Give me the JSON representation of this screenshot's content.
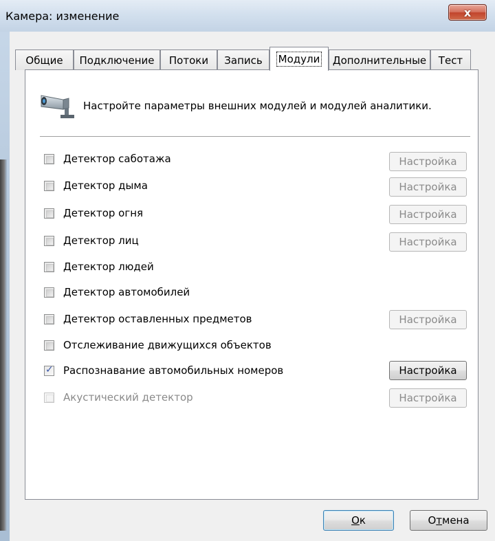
{
  "window": {
    "title": "Камера: изменение",
    "close_glyph": "x"
  },
  "tabs": [
    {
      "label": "Общие",
      "active": false
    },
    {
      "label": "Подключение",
      "active": false
    },
    {
      "label": "Потоки",
      "active": false
    },
    {
      "label": "Запись",
      "active": false
    },
    {
      "label": "Модули",
      "active": true
    },
    {
      "label": "Дополнительные",
      "active": false
    },
    {
      "label": "Тест",
      "active": false
    }
  ],
  "panel": {
    "icon": "camera-icon",
    "intro": "Настройте параметры внешних модулей и модулей аналитики."
  },
  "modules": [
    {
      "label": "Детектор саботажа",
      "checked": false,
      "enabled": true,
      "settings_label": "Настройка",
      "settings_enabled": false
    },
    {
      "label": "Детектор дыма",
      "checked": false,
      "enabled": true,
      "settings_label": "Настройка",
      "settings_enabled": false
    },
    {
      "label": "Детектор огня",
      "checked": false,
      "enabled": true,
      "settings_label": "Настройка",
      "settings_enabled": false
    },
    {
      "label": "Детектор лиц",
      "checked": false,
      "enabled": true,
      "settings_label": "Настройка",
      "settings_enabled": false
    },
    {
      "label": "Детектор людей",
      "checked": false,
      "enabled": true,
      "settings_label": null,
      "settings_enabled": false
    },
    {
      "label": "Детектор автомобилей",
      "checked": false,
      "enabled": true,
      "settings_label": null,
      "settings_enabled": false
    },
    {
      "label": "Детектор оставленных предметов",
      "checked": false,
      "enabled": true,
      "settings_label": "Настройка",
      "settings_enabled": false
    },
    {
      "label": "Отслеживание движущихся объектов",
      "checked": false,
      "enabled": true,
      "settings_label": null,
      "settings_enabled": false
    },
    {
      "label": "Распознавание автомобильных номеров",
      "checked": true,
      "enabled": true,
      "settings_label": "Настройка",
      "settings_enabled": true
    },
    {
      "label": "Акустический детектор",
      "checked": false,
      "enabled": false,
      "settings_label": "Настройка",
      "settings_enabled": false
    }
  ],
  "buttons": {
    "ok": {
      "mnemonic": "О",
      "rest": "к"
    },
    "cancel": {
      "before": "О",
      "mnemonic": "т",
      "rest": "мена"
    }
  },
  "colors": {
    "frame": "#b5c8dc",
    "close_button": "#c1442c",
    "check_mark": "#3a57a8",
    "disabled_text": "#8a8a8a"
  }
}
